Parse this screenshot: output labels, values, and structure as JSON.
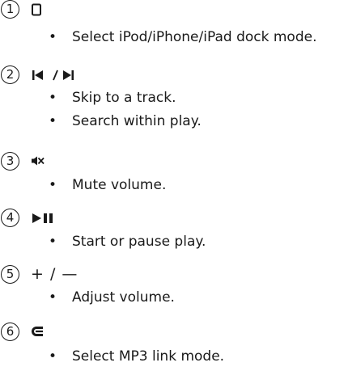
{
  "items": [
    {
      "number": "1",
      "symbol_icon": "dock-icon",
      "bullets": [
        "Select iPod/iPhone/iPad dock mode."
      ]
    },
    {
      "number": "2",
      "symbol_icon": "previous-next-icon",
      "symbol_separator": "/",
      "bullets": [
        "Skip to a track.",
        "Search within play."
      ]
    },
    {
      "number": "3",
      "symbol_icon": "mute-icon",
      "bullets": [
        "Mute volume."
      ]
    },
    {
      "number": "4",
      "symbol_icon": "play-pause-icon",
      "bullets": [
        "Start or pause play."
      ]
    },
    {
      "number": "5",
      "symbol_text": "+ / —",
      "bullets": [
        "Adjust volume."
      ]
    },
    {
      "number": "6",
      "symbol_icon": "mp3-link-icon",
      "bullets": [
        "Select MP3 link mode."
      ]
    }
  ],
  "bullet_char": "•"
}
